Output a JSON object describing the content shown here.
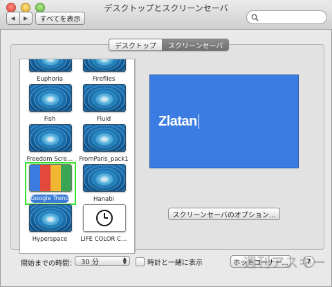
{
  "window": {
    "title": "デスクトップとスクリーンセーバ"
  },
  "toolbar": {
    "back_icon": "chevron-left-icon",
    "forward_icon": "chevron-right-icon",
    "show_all_label": "すべてを表示",
    "search": {
      "value": "",
      "placeholder": "",
      "icon": "search-icon"
    }
  },
  "tabs": [
    {
      "label": "デスクトップ",
      "active": false
    },
    {
      "label": "スクリーンセーバ",
      "active": true
    }
  ],
  "savers": [
    {
      "name": "Euphoria",
      "thumb": "swirl"
    },
    {
      "name": "Fireflies",
      "thumb": "swirl"
    },
    {
      "name": "Fish",
      "thumb": "swirl"
    },
    {
      "name": "Fluid",
      "thumb": "swirl"
    },
    {
      "name": "Freedom Scre…",
      "thumb": "swirl"
    },
    {
      "name": "FromParis_pack1",
      "thumb": "swirl"
    },
    {
      "name": "Google Trends",
      "thumb": "trends",
      "selected": true
    },
    {
      "name": "Hanabi",
      "thumb": "swirl"
    },
    {
      "name": "Hyperspace",
      "thumb": "swirl"
    },
    {
      "name": "LIFE COLOR C…",
      "thumb": "clock"
    }
  ],
  "preview": {
    "text": "Zlatan"
  },
  "options_button": "スクリーンセーバのオプション...",
  "start": {
    "label": "開始までの時間：",
    "value": "30 分"
  },
  "show_clock": {
    "label": "時計と一緒に表示",
    "checked": false
  },
  "hot_corners_button": "ホットコーナー...",
  "help_label": "?",
  "watermark": "週刊アスキー",
  "colors": {
    "preview_bg": "#3b7ce2",
    "selection_outline": "#33e02b",
    "selected_label_bg": "#3a7bd5",
    "trends_stripes": [
      "#3b7ce2",
      "#e2483b",
      "#f2b632",
      "#3aa655"
    ]
  }
}
